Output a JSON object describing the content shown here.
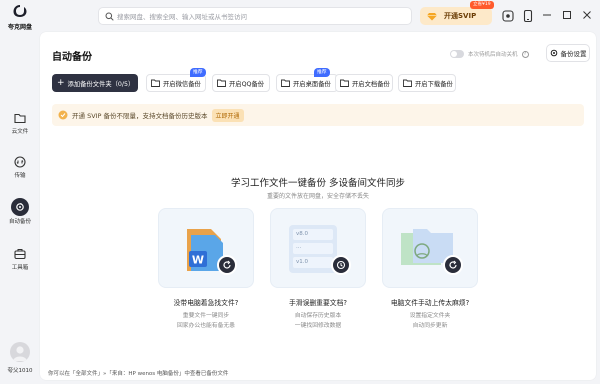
{
  "app": {
    "name": "夸克网盘"
  },
  "search": {
    "placeholder": "搜索网盘、搜索全网、输入网址或从书签访问"
  },
  "svip": {
    "button_label": "开通SVIP",
    "promo_tag": "立省¥19"
  },
  "sidebar": {
    "items": [
      {
        "label": "云文件",
        "icon": "folder-icon"
      },
      {
        "label": "传输",
        "icon": "transfer-icon"
      },
      {
        "label": "自动备份",
        "icon": "backup-icon",
        "active": true
      },
      {
        "label": "工具箱",
        "icon": "toolbox-icon"
      }
    ],
    "user_name": "夸父1010"
  },
  "header": {
    "title": "自动备份",
    "auto_toggle_label": "本次待机后自动关机",
    "settings_label": "备份设置"
  },
  "actions": {
    "add_folder": "添加备份文件夹（0/5）",
    "options": [
      {
        "label": "开启微信备份",
        "badge": "推荐"
      },
      {
        "label": "开启QQ备份",
        "badge": ""
      },
      {
        "label": "开启桌面备份",
        "badge": "推荐"
      },
      {
        "label": "开启文档备份",
        "badge": ""
      },
      {
        "label": "开启下载备份",
        "badge": ""
      }
    ]
  },
  "banner": {
    "text": "开通 SVIP 备份不限量，支持文档备份历史版本",
    "cta": "立即开通"
  },
  "hero": {
    "title": "学习工作文件一键备份 多设备间文件同步",
    "subtitle": "重要的文件放在网盘，安全存储不丢失"
  },
  "cards": [
    {
      "title": "没带电脑着急找文件?",
      "lines": [
        "重要文件一键同步",
        "回家办公也能有备无患"
      ],
      "icon": "word-file-icon"
    },
    {
      "title": "手滑误删重要文档?",
      "lines": [
        "自动保存历史版本",
        "一键找回修改数据"
      ],
      "icon": "version-history-icon",
      "versions": [
        "v8.0",
        "...",
        "v1.0"
      ]
    },
    {
      "title": "电脑文件手动上传太麻烦?",
      "lines": [
        "设置指定文件夹",
        "自动同步更新"
      ],
      "icon": "sync-folder-icon"
    }
  ],
  "footer": {
    "note": "你可以在「全部文件」»「来自：HP wenos 电脑备份」中查看已备份文件"
  },
  "colors": {
    "accent": "#2f3242",
    "svip": "#fde9c9",
    "banner": "#fdf5e9",
    "badge": "#3f6cff"
  }
}
